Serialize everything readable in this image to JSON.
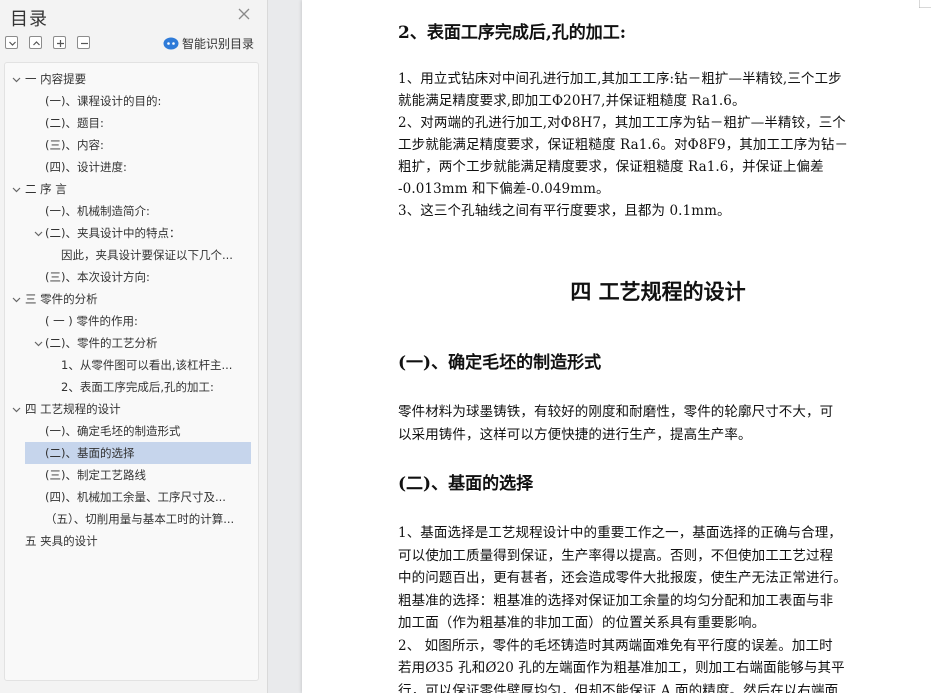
{
  "sidebar": {
    "title": "目录",
    "smart_toc_label": "智能识别目录",
    "toolbar_icons": [
      "collapse-all-icon",
      "expand-icon",
      "add-icon",
      "remove-icon"
    ],
    "items": [
      {
        "label": "一   内容提要",
        "level": 0,
        "expanded": true
      },
      {
        "label": "(一)、课程设计的目的:",
        "level": 1
      },
      {
        "label": "(二)、题目:",
        "level": 1
      },
      {
        "label": "(三)、内容:",
        "level": 1
      },
      {
        "label": "(四)、设计进度:",
        "level": 1
      },
      {
        "label": "二   序      言",
        "level": 0,
        "expanded": true
      },
      {
        "label": "(一)、机械制造简介:",
        "level": 1
      },
      {
        "label": "(二)、夹具设计中的特点：",
        "level": 1,
        "expanded": true
      },
      {
        "label": "因此，夹具设计要保证以下几个...",
        "level": 2
      },
      {
        "label": "(三)、本次设计方向:",
        "level": 1
      },
      {
        "label": "三   零件的分析",
        "level": 0,
        "expanded": true
      },
      {
        "label": "( 一 ) 零件的作用:",
        "level": 1
      },
      {
        "label": "(二)、零件的工艺分析",
        "level": 1,
        "expanded": true
      },
      {
        "label": "1、从零件图可以看出,该杠杆主...",
        "level": 2
      },
      {
        "label": "2、表面工序完成后,孔的加工:",
        "level": 2
      },
      {
        "label": "四  工艺规程的设计",
        "level": 0,
        "expanded": true
      },
      {
        "label": "(一)、确定毛坯的制造形式",
        "level": 1
      },
      {
        "label": "(二)、基面的选择",
        "level": 1,
        "selected": true
      },
      {
        "label": "(三)、制定工艺路线",
        "level": 1
      },
      {
        "label": "(四)、机械加工余量、工序尺寸及...",
        "level": 1
      },
      {
        "label": "（五）、切削用量与基本工时的计算...",
        "level": 1
      },
      {
        "label": "五   夹具的设计",
        "level": 0
      }
    ]
  },
  "document": {
    "section_heading": "2、表面工序完成后,孔的加工:",
    "para1": [
      "1、用立式钻床对中间孔进行加工,其加工工序:钻－粗扩—半精铰,三个工步",
      "就能满足精度要求,即加工Φ20H7,并保证粗糙度 Ra1.6。",
      "2、对两端的孔进行加工,对Φ8H7，其加工工序为钻－粗扩—半精铰，三个",
      "工步就能满足精度要求，保证粗糙度 Ra1.6。对Φ8F9，其加工工序为钻－",
      "粗扩，两个工步就能满足精度要求，保证粗糙度 Ra1.6，并保证上偏差",
      "-0.013mm 和下偏差-0.049mm。",
      "3、这三个孔轴线之间有平行度要求，且都为 0.1mm。"
    ],
    "chapter_title": "四  工艺规程的设计",
    "sub1_title": "(一)、确定毛坯的制造形式",
    "sub1_body": [
      "零件材料为球墨铸铁，有较好的刚度和耐磨性，零件的轮廓尺寸不大，可",
      "以采用铸件，这样可以方便快捷的进行生产，提高生产率。"
    ],
    "sub2_title": "(二)、基面的选择",
    "sub2_body": [
      "1、基面选择是工艺规程设计中的重要工作之一，基面选择的正确与合理，",
      "可以使加工质量得到保证，生产率得以提高。否则，不但使加工工艺过程",
      "中的问题百出，更有甚者，还会造成零件大批报废，使生产无法正常进行。",
      "粗基准的选择：粗基准的选择对保证加工余量的均匀分配和加工表面与非",
      "加工面（作为粗基准的非加工面）的位置关系具有重要影响。",
      "2、   如图所示，零件的毛坯铸造时其两端面难免有平行度的误差。加工时",
      "若用Ø35 孔和Ø20 孔的左端面作为粗基准加工，则加工右端面能够与其平",
      "行，可以保证零件壁厚均匀，但却不能保证 A 面的精度。然后在以右端面"
    ]
  },
  "colors": {
    "sidebar_bg": "#f3f3f3",
    "selected_bg": "#c6d5ec",
    "accent_blue": "#2f7bd8",
    "page_bg": "#ffffff"
  }
}
